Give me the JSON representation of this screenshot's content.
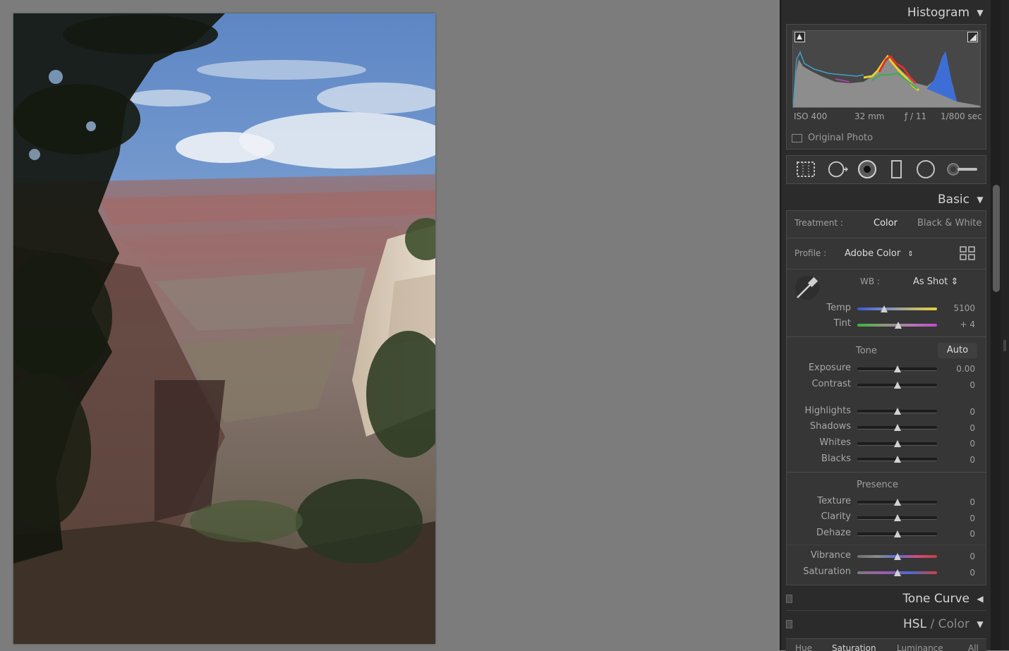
{
  "photo": {
    "alt": ""
  },
  "histogram": {
    "title": "Histogram",
    "iso": "ISO 400",
    "focal": "32 mm",
    "aperture": "ƒ / 11",
    "shutter": "1/800 sec",
    "original_photo": "Original Photo"
  },
  "basic": {
    "title": "Basic",
    "treatment_label": "Treatment :",
    "treatment_color": "Color",
    "treatment_bw": "Black & White",
    "profile_label": "Profile :",
    "profile_value": "Adobe Color",
    "profile_arrows": "⇕",
    "wb_label": "WB :",
    "wb_value": "As Shot ⇕",
    "temp_label": "Temp",
    "temp_value": "5100",
    "tint_label": "Tint",
    "tint_value": "+ 4",
    "tone_label": "Tone",
    "auto_label": "Auto",
    "exposure_label": "Exposure",
    "exposure_value": "0.00",
    "contrast_label": "Contrast",
    "contrast_value": "0",
    "highlights_label": "Highlights",
    "highlights_value": "0",
    "shadows_label": "Shadows",
    "shadows_value": "0",
    "whites_label": "Whites",
    "whites_value": "0",
    "blacks_label": "Blacks",
    "blacks_value": "0",
    "presence_label": "Presence",
    "texture_label": "Texture",
    "texture_value": "0",
    "clarity_label": "Clarity",
    "clarity_value": "0",
    "dehaze_label": "Dehaze",
    "dehaze_value": "0",
    "vibrance_label": "Vibrance",
    "vibrance_value": "0",
    "saturation_label": "Saturation",
    "saturation_value": "0"
  },
  "tone_curve": {
    "title": "Tone Curve"
  },
  "hsl": {
    "title_hsl": "HSL",
    "title_sep": " / ",
    "title_color": "Color",
    "tabs": [
      "Hue",
      "Saturation",
      "Luminance",
      "All"
    ]
  },
  "slider_levels": {
    "temp": 0.34,
    "tint": 0.51,
    "neutral": 0.5
  },
  "colors": {
    "panel": "#2b2b2b",
    "workspace": "#7c7c7c",
    "accent_text": "#d4d4d4"
  }
}
